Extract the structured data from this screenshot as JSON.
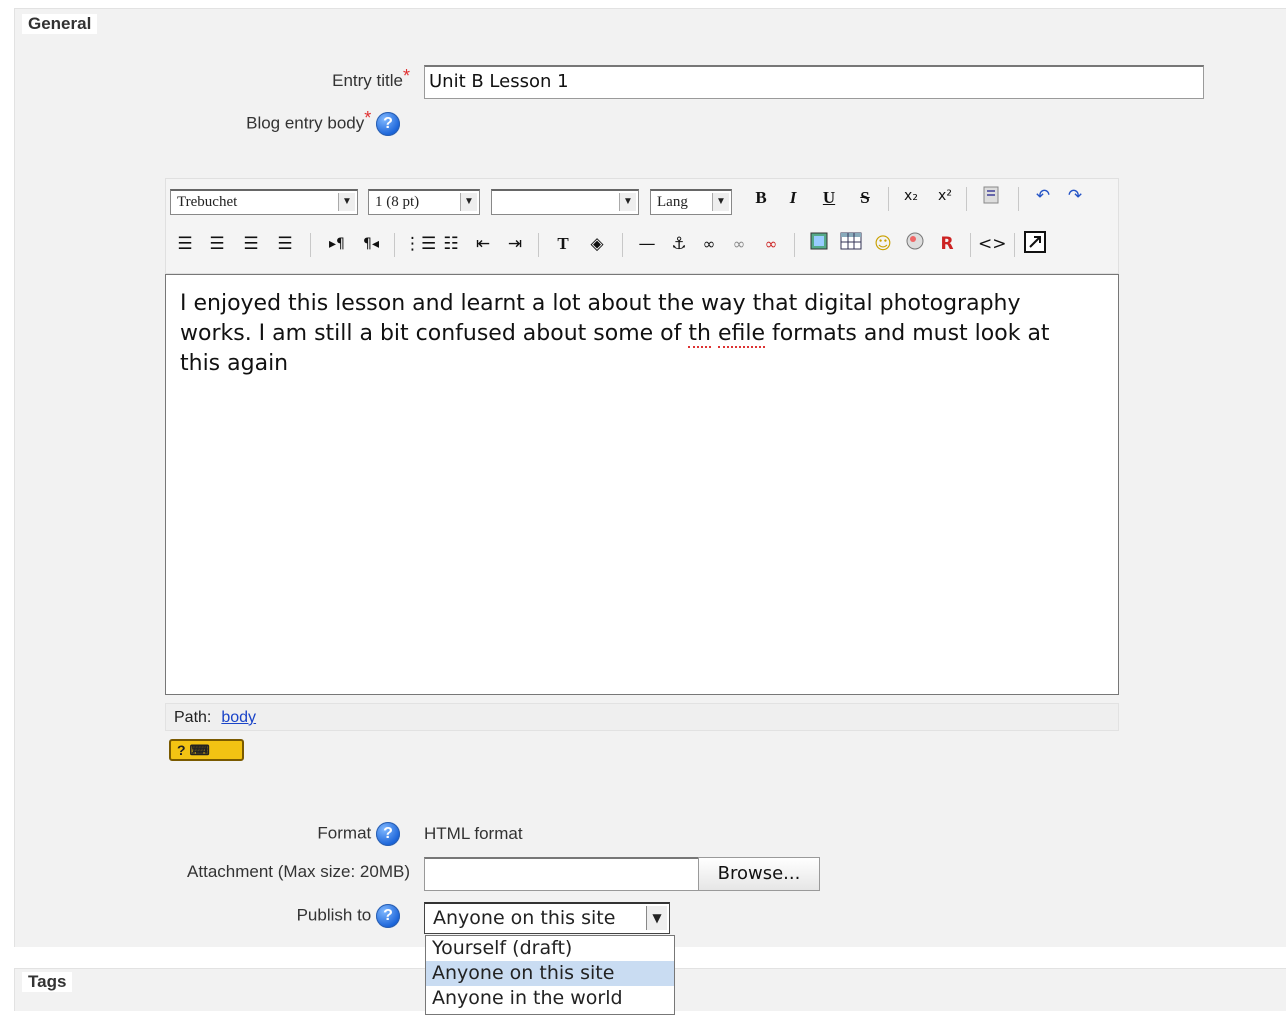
{
  "sections": {
    "general": "General",
    "tags": "Tags"
  },
  "entry_title": {
    "label": "Entry title",
    "required_mark": "*",
    "value": "Unit B Lesson 1"
  },
  "blog_body": {
    "label": "Blog entry body",
    "required_mark": "*",
    "help_icon": "help-icon"
  },
  "editor": {
    "font_select": "Trebuchet",
    "size_select": "1 (8 pt)",
    "style_select": "",
    "lang_select": "Lang",
    "buttons": {
      "bold": "B",
      "italic": "I",
      "underline": "U",
      "strike": "S",
      "subscript": "x₂",
      "superscript": "x²",
      "undo": "↶",
      "redo": "↷",
      "source": "<>"
    },
    "content_line1": "I enjoyed this lesson and learnt a lot about the way that digital photography",
    "content_line2_a": "works.  I am still a bit confused about some of ",
    "content_line2_spell1": "th",
    "content_line2_space": " ",
    "content_line2_spell2": "efile",
    "content_line2_b": " formats and must look at",
    "content_line3": "this again",
    "path_label": "Path:",
    "path_link": "body",
    "keyboard_help": "? ⌨"
  },
  "format": {
    "label": "Format",
    "value": "HTML format"
  },
  "attachment": {
    "label": "Attachment (Max size: 20MB)",
    "value": "",
    "browse_label": "Browse..."
  },
  "publish_to": {
    "label": "Publish to",
    "selected": "Anyone on this site",
    "options": [
      "Yourself (draft)",
      "Anyone on this site",
      "Anyone in the world"
    ]
  }
}
